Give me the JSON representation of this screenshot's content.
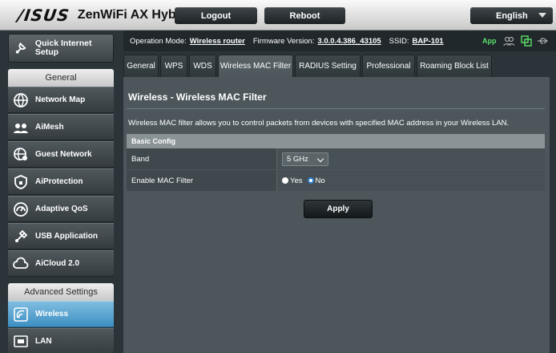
{
  "header": {
    "logo": "/ISUS",
    "product": "ZenWiFi AX Hybrid",
    "logout_label": "Logout",
    "reboot_label": "Reboot",
    "language": "English"
  },
  "sidebar": {
    "quick_setup": "Quick Internet Setup",
    "general_heading": "General",
    "general_items": [
      {
        "label": "Network Map",
        "icon": "network-map-icon"
      },
      {
        "label": "AiMesh",
        "icon": "aimesh-icon"
      },
      {
        "label": "Guest Network",
        "icon": "guest-network-icon"
      },
      {
        "label": "AiProtection",
        "icon": "aiprotection-icon"
      },
      {
        "label": "Adaptive QoS",
        "icon": "adaptive-qos-icon"
      },
      {
        "label": "USB Application",
        "icon": "usb-application-icon"
      },
      {
        "label": "AiCloud 2.0",
        "icon": "aicloud-icon"
      }
    ],
    "advanced_heading": "Advanced Settings",
    "advanced_items": [
      {
        "label": "Wireless",
        "icon": "wireless-icon",
        "active": true
      },
      {
        "label": "LAN",
        "icon": "lan-icon"
      }
    ]
  },
  "status_bar": {
    "op_mode_label": "Operation Mode:",
    "op_mode_value": "Wireless router",
    "fw_label": "Firmware Version:",
    "fw_value": "3.0.0.4.386_43105",
    "ssid_label": "SSID:",
    "ssid_value": "BAP-101",
    "app_label": "App"
  },
  "tabs": [
    {
      "label": "General"
    },
    {
      "label": "WPS"
    },
    {
      "label": "WDS"
    },
    {
      "label": "Wireless MAC Filter",
      "active": true
    },
    {
      "label": "RADIUS Setting"
    },
    {
      "label": "Professional"
    },
    {
      "label": "Roaming Block List"
    }
  ],
  "main": {
    "title": "Wireless - Wireless MAC Filter",
    "description": "Wireless MAC filter allows you to control packets from devices with specified MAC address in your Wireless LAN.",
    "section_title": "Basic Config",
    "band_label": "Band",
    "band_value": "5 GHz",
    "mac_filter_label": "Enable MAC Filter",
    "yes_label": "Yes",
    "no_label": "No",
    "mac_filter_selected": "No",
    "apply_label": "Apply"
  },
  "colors": {
    "active_nav": "#3d8fc2",
    "app_green": "#5ee06a",
    "radio_selected": "#2f7fd0"
  }
}
